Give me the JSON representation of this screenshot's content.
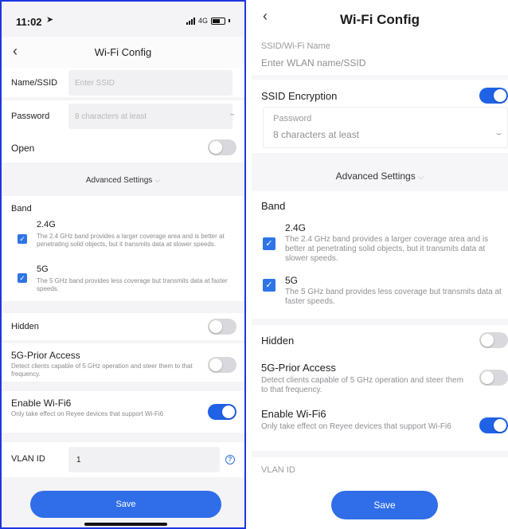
{
  "colors": {
    "accent": "#2f6ee8",
    "frame": "#1d36e0",
    "toggle_off": "#d9d9dd"
  },
  "left": {
    "status": {
      "time": "11:02",
      "network": "4G"
    },
    "nav": {
      "back": "‹",
      "title": "Wi-Fi Config"
    },
    "ssid": {
      "label": "Name/SSID",
      "placeholder": "Enter SSID"
    },
    "password": {
      "label": "Password",
      "placeholder": "8 characters at least",
      "eye": "⌣"
    },
    "open": {
      "label": "Open",
      "state": "off"
    },
    "advanced": {
      "label": "Advanced Settings",
      "chevron": "⌵"
    },
    "band": {
      "label": "Band",
      "options": [
        {
          "name": "2.4G",
          "checked": true,
          "desc": "The 2.4 GHz band provides a larger coverage area and is better at penetrating solid objects, but it transmits data at slower speeds."
        },
        {
          "name": "5G",
          "checked": true,
          "desc": "The 5 GHz band provides less coverage but transmits data at faster speeds."
        }
      ]
    },
    "hidden": {
      "label": "Hidden",
      "state": "off"
    },
    "prior": {
      "label": "5G-Prior Access",
      "desc": "Detect clients capable of 5 GHz operation and steer them to that frequency.",
      "state": "off"
    },
    "wifi6": {
      "label": "Enable Wi-Fi6",
      "desc": "Only take effect on Reyee devices that support Wi-Fi6",
      "state": "on"
    },
    "vlan": {
      "label": "VLAN ID",
      "value": "1",
      "help": "?"
    },
    "save": "Save"
  },
  "right": {
    "nav": {
      "back": "‹",
      "title": "Wi-Fi Config"
    },
    "ssid": {
      "label": "SSID/Wi-Fi Name",
      "placeholder": "Enter WLAN name/SSID"
    },
    "encryption": {
      "label": "SSID Encryption",
      "state": "on"
    },
    "password": {
      "label": "Password",
      "placeholder": "8 characters at least",
      "eye": "⌣"
    },
    "advanced": {
      "label": "Advanced Settings",
      "chevron": "⌵"
    },
    "band": {
      "label": "Band",
      "options": [
        {
          "name": "2.4G",
          "checked": true,
          "desc": "The 2.4 GHz band provides a larger coverage area and is better at penetrating solid objects, but it transmits data at slower speeds."
        },
        {
          "name": "5G",
          "checked": true,
          "desc": "The 5 GHz band provides less coverage but transmits data at faster speeds."
        }
      ]
    },
    "hidden": {
      "label": "Hidden",
      "state": "off"
    },
    "prior": {
      "label": "5G-Prior Access",
      "desc": "Detect clients capable of 5 GHz operation and steer them to that frequency.",
      "state": "off"
    },
    "wifi6": {
      "label": "Enable Wi-Fi6",
      "desc": "Only take effect on Reyee devices that support Wi-Fi6",
      "state": "on"
    },
    "vlan": {
      "label": "VLAN ID"
    },
    "save": "Save"
  }
}
